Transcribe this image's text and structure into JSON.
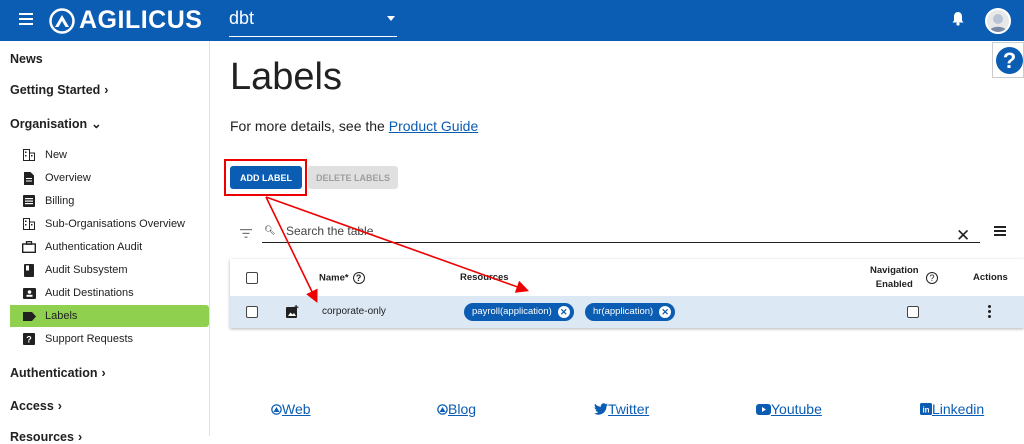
{
  "topbar": {
    "brand": "AGILICUS",
    "org_selector_value": "dbt",
    "icons": [
      "menu-icon",
      "agilicus-logo-icon",
      "bell-icon",
      "avatar",
      "help-icon"
    ],
    "color": "#0b5cb3"
  },
  "help": {
    "label": "?"
  },
  "sidebar": {
    "sections": {
      "news": "News",
      "getting_started": "Getting Started",
      "organisation": "Organisation",
      "authentication": "Authentication",
      "access": "Access",
      "resources": "Resources"
    },
    "items": [
      {
        "label": "New",
        "icon": "building-icon"
      },
      {
        "label": "Overview",
        "icon": "document-icon"
      },
      {
        "label": "Billing",
        "icon": "list-icon"
      },
      {
        "label": "Sub-Organisations Overview",
        "icon": "building-icon"
      },
      {
        "label": "Authentication Audit",
        "icon": "briefcase-icon"
      },
      {
        "label": "Audit Subsystem",
        "icon": "book-icon"
      },
      {
        "label": "Audit Destinations",
        "icon": "contact-icon"
      },
      {
        "label": "Labels",
        "icon": "label-icon",
        "active": true
      },
      {
        "label": "Support Requests",
        "icon": "help-box-icon"
      }
    ]
  },
  "main": {
    "title": "Labels",
    "details_prefix": "For more details, see the ",
    "details_link": "Product Guide",
    "add_label_button": "ADD LABEL",
    "delete_labels_button": "DELETE LABELS",
    "search_placeholder": "Search the table",
    "clear_symbol": "✕"
  },
  "table": {
    "columns": {
      "name": "Name*",
      "resources": "Resources",
      "navigation_line1": "Navigation",
      "navigation_line2": "Enabled",
      "actions": "Actions"
    },
    "rows": [
      {
        "name": "corporate-only",
        "resources": [
          "payroll(application)",
          "hr(application)"
        ],
        "navigation_enabled": false
      }
    ]
  },
  "footer": {
    "links": [
      "Web",
      "Blog",
      "Twitter",
      "Youtube",
      "Linkedin"
    ]
  },
  "colors": {
    "primary": "#0b5cb3",
    "active_nav": "#8fd14f",
    "highlight": "#e00000",
    "row_selected": "#dde8f5"
  }
}
